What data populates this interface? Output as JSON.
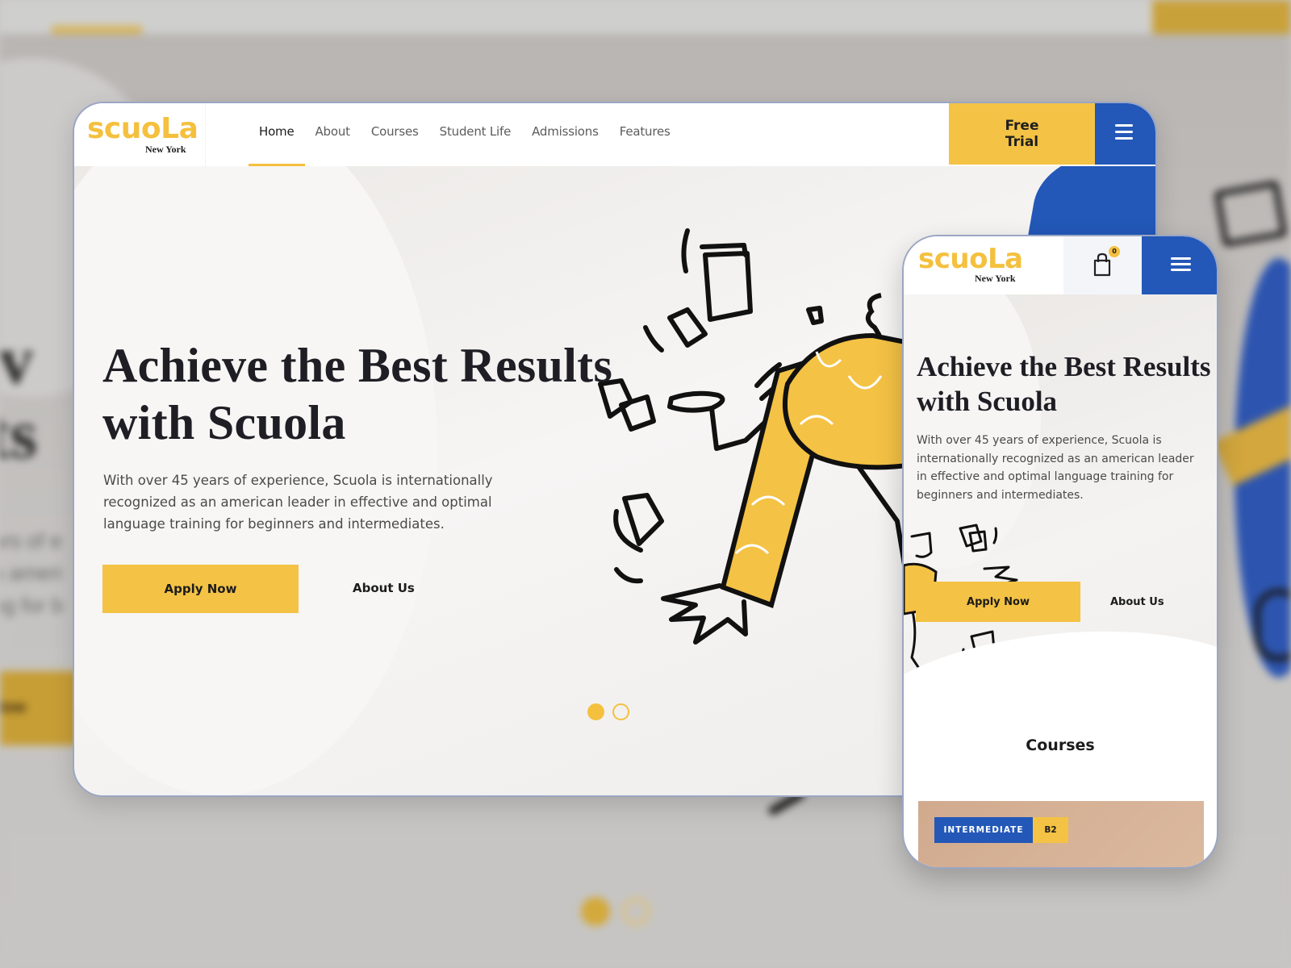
{
  "brand": {
    "name": "scuoLa",
    "location": "New York",
    "colors": {
      "primary_yellow": "#f4c244",
      "primary_blue": "#2358b8",
      "text_dark": "#1e1e24"
    }
  },
  "background": {
    "heading_fragment_1": "ev",
    "heading_fragment_2": "lts",
    "para_fragment_1": "ars of e",
    "para_fragment_2": "n ameri",
    "para_fragment_3": "ng for b",
    "apply_fragment": "Now"
  },
  "desktop": {
    "nav": [
      {
        "label": "Home",
        "active": true
      },
      {
        "label": "About",
        "active": false
      },
      {
        "label": "Courses",
        "active": false
      },
      {
        "label": "Student Life",
        "active": false
      },
      {
        "label": "Admissions",
        "active": false
      },
      {
        "label": "Features",
        "active": false
      }
    ],
    "free_trial_label": "Free Trial",
    "menu_icon": "hamburger-icon",
    "hero": {
      "title": "Achieve the Best Results with Scuola",
      "description": "With over 45 years of experience, Scuola is internationally recognized as an american leader in effective and optimal language training for beginners and intermediates.",
      "apply_label": "Apply Now",
      "about_label": "About Us"
    },
    "slider": {
      "total": 2,
      "active_index": 0
    }
  },
  "mobile": {
    "cart_icon": "shopping-bag-icon",
    "cart_count": "0",
    "menu_icon": "hamburger-icon",
    "hero": {
      "title": "Achieve the Best Results with Scuola",
      "description": "With over 45 years of experience, Scuola is internationally recognized as an american leader in effective and optimal language training for beginners and intermediates.",
      "apply_label": "Apply Now",
      "about_label": "About Us"
    },
    "courses_heading": "Courses",
    "course_card": {
      "level": "INTERMEDIATE",
      "code": "B2"
    }
  }
}
